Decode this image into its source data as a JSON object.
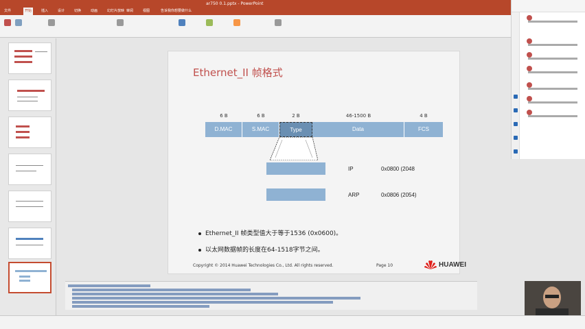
{
  "window": {
    "title": "ar750 0.1.pptx - PowerPoint"
  },
  "menu": {
    "tabs": [
      "文件",
      "开始",
      "插入",
      "设计",
      "切换",
      "动画",
      "幻灯片放映",
      "审阅",
      "视图",
      "告诉我你想要做什么"
    ],
    "active": "开始"
  },
  "slide": {
    "title": "Ethernet_II 帧格式",
    "frame_fields": [
      {
        "size": "6 B",
        "name": "D.MAC"
      },
      {
        "size": "6 B",
        "name": "S.MAC"
      },
      {
        "size": "2 B",
        "name": "Type"
      },
      {
        "size": "46-1500 B",
        "name": "Data"
      },
      {
        "size": "4 B",
        "name": "FCS"
      }
    ],
    "protocols": [
      {
        "name": "IP",
        "code": "0x0800 (2048"
      },
      {
        "name": "ARP",
        "code": "0x0806 (2054)"
      }
    ],
    "bullets": [
      "Ethernet_II 帧类型值大于等于1536 (0x0600)。",
      "以太网数据帧的长度在64-1518字节之间。"
    ],
    "footer": {
      "copyright": "Copyright © 2014 Huawei Technologies Co., Ltd. All rights reserved.",
      "page": "Page 10",
      "brand": "HUAWEI"
    }
  },
  "colors": {
    "accent": "#b7472a",
    "title": "#c0504d",
    "field": "#8fb2d3"
  }
}
